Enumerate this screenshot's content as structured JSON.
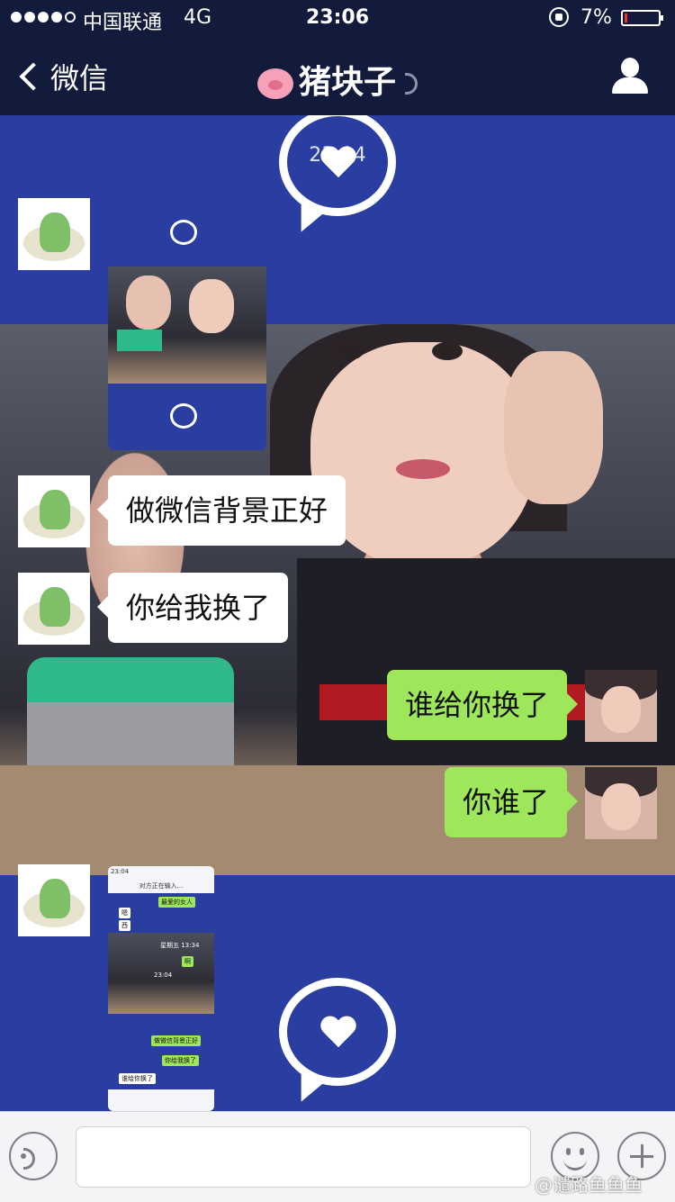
{
  "status_bar": {
    "carrier": "中国联通",
    "network": "4G",
    "time": "23:06",
    "battery_percent": "7%",
    "signal_bars": 4,
    "signal_max": 5
  },
  "nav": {
    "back_label": "微信",
    "title": "猪块子",
    "title_icon": "pig-face-emoji",
    "right_icon": "profile-icon",
    "status_icon": "ear-icon"
  },
  "chat": {
    "timestamp": "23:04",
    "messages": [
      {
        "type": "image",
        "from": "other"
      },
      {
        "type": "text",
        "from": "other",
        "text": "做微信背景正好"
      },
      {
        "type": "text",
        "from": "other",
        "text": "你给我换了"
      },
      {
        "type": "text",
        "from": "me",
        "text": "谁给你换了"
      },
      {
        "type": "text",
        "from": "me",
        "text": "你谁了"
      },
      {
        "type": "image",
        "from": "other"
      }
    ],
    "thumbnail": {
      "time": "23:04",
      "title": "对方正在输入...",
      "bubbles": [
        "最爱的女人",
        "嗯",
        "西",
        "啊",
        "做微信背景正好",
        "你给我换了",
        "谁给你换了"
      ],
      "stamp": "星期五 13:34",
      "stamp2": "23:04"
    }
  },
  "input_bar": {
    "text_value": "",
    "voice_icon": "voice-icon",
    "emoji_icon": "emoji-icon",
    "plus_icon": "plus-icon"
  },
  "watermark": "@谴路鱼鱼鱼",
  "colors": {
    "nav_bg": "#131b3c",
    "chat_bg": "#2a3da0",
    "bubble_out": "#9ee75b",
    "bubble_in": "#ffffff"
  }
}
